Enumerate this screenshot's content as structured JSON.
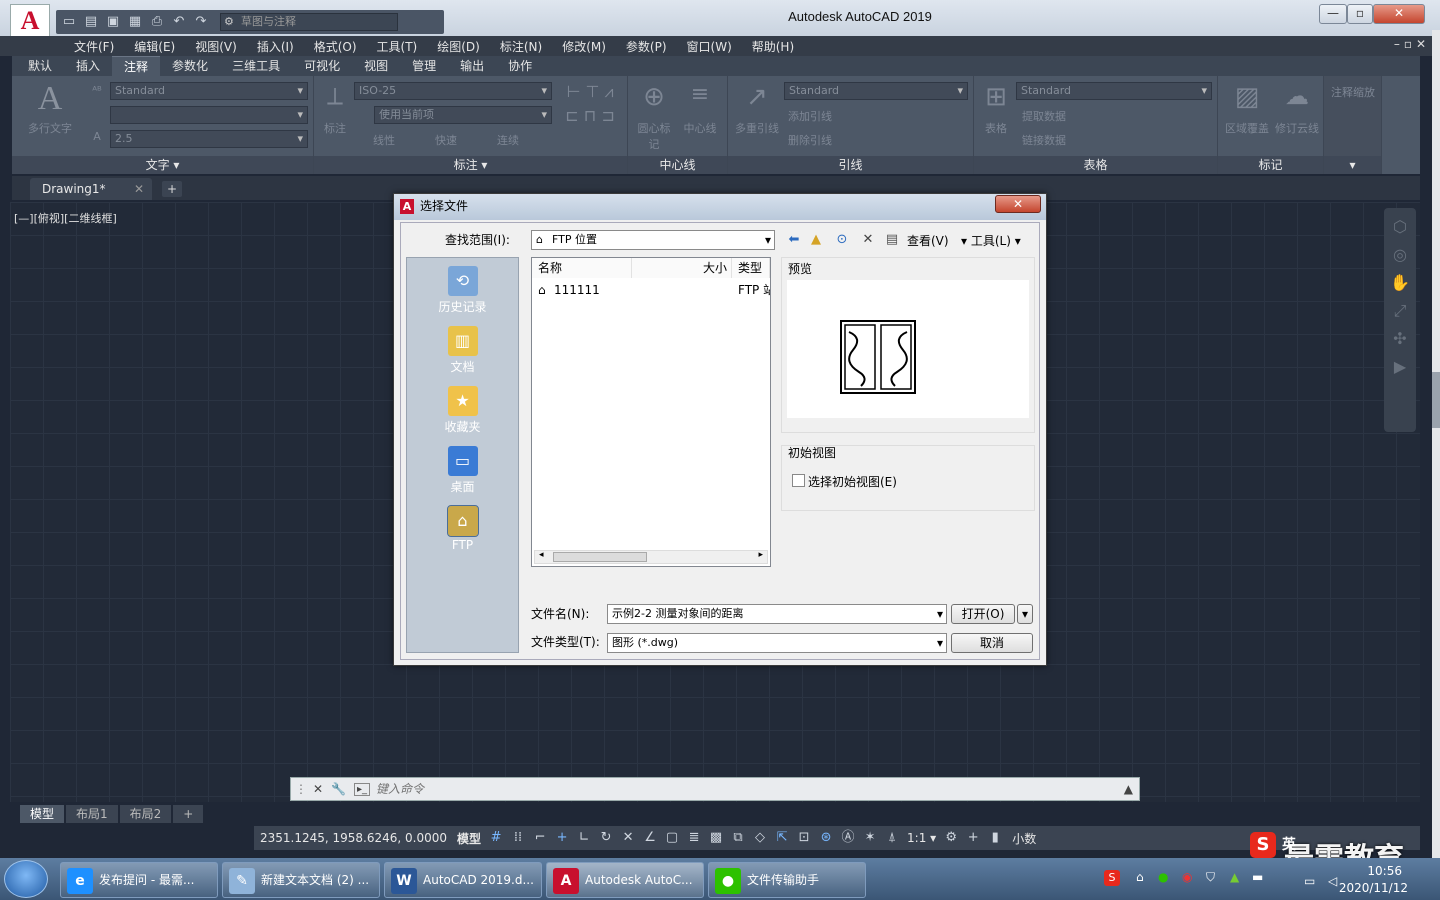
{
  "app": {
    "title": "Autodesk AutoCAD 2019",
    "logo_letter": "A",
    "workspace": "草图与注释"
  },
  "menubar": [
    "文件(F)",
    "编辑(E)",
    "视图(V)",
    "插入(I)",
    "格式(O)",
    "工具(T)",
    "绘图(D)",
    "标注(N)",
    "修改(M)",
    "参数(P)",
    "窗口(W)",
    "帮助(H)"
  ],
  "ribbon_tabs": [
    {
      "label": "默认",
      "active": false
    },
    {
      "label": "插入",
      "active": false
    },
    {
      "label": "注释",
      "active": true
    },
    {
      "label": "参数化",
      "active": false
    },
    {
      "label": "三维工具",
      "active": false
    },
    {
      "label": "可视化",
      "active": false
    },
    {
      "label": "视图",
      "active": false
    },
    {
      "label": "管理",
      "active": false
    },
    {
      "label": "输出",
      "active": false
    },
    {
      "label": "协作",
      "active": false
    }
  ],
  "ribbon": {
    "text_group": {
      "title": "文字 ▾",
      "mtext": "多行文字",
      "style": "Standard",
      "height": "2.5"
    },
    "dim_group": {
      "title": "标注 ▾",
      "dim": "标注",
      "style": "ISO-25",
      "layer": "使用当前项",
      "linear": "线性",
      "quick": "快速",
      "continue": "连续"
    },
    "center_group": {
      "title": "中心线",
      "center_mark": "圆心标记",
      "centerline": "中心线"
    },
    "leader_group": {
      "title": "引线",
      "mleader": "多重引线",
      "style": "Standard",
      "add": "添加引线",
      "remove": "删除引线"
    },
    "table_group": {
      "title": "表格",
      "table": "表格",
      "style": "Standard",
      "extract": "提取数据",
      "link": "链接数据"
    },
    "markup_group": {
      "title": "标记",
      "wipeout": "区域覆盖",
      "revcloud": "修订云线"
    },
    "scale_group": {
      "title": "注释缩放"
    }
  },
  "doc_tab": {
    "name": "Drawing1*",
    "add": "+"
  },
  "viewport_label": "[—][俯视][二维线框]",
  "command": {
    "placeholder": "键入命令"
  },
  "layout_tabs": [
    {
      "label": "模型",
      "active": true
    },
    {
      "label": "布局1",
      "active": false
    },
    {
      "label": "布局2",
      "active": false
    },
    {
      "label": "+",
      "active": false
    }
  ],
  "status": {
    "coords": "2351.1245, 1958.6246, 0.0000",
    "model": "模型",
    "scale": "1:1 ▾",
    "units": "小数"
  },
  "dialog": {
    "title": "选择文件",
    "look_in_label": "查找范围(I):",
    "look_in_value": "FTP 位置",
    "view_label": "查看(V)",
    "tools_label": "工具(L)",
    "places": [
      {
        "label": "历史记录",
        "icon": "history-icon",
        "selected": false
      },
      {
        "label": "文档",
        "icon": "documents-icon",
        "selected": false
      },
      {
        "label": "收藏夹",
        "icon": "favorites-icon",
        "selected": false
      },
      {
        "label": "桌面",
        "icon": "desktop-icon",
        "selected": false
      },
      {
        "label": "FTP",
        "icon": "ftp-icon",
        "selected": true
      }
    ],
    "columns": {
      "name": "名称",
      "size": "大小",
      "type": "类型"
    },
    "files": [
      {
        "name": "111111",
        "type": "FTP 站"
      }
    ],
    "preview_label": "预览",
    "initial_view_label": "初始视图",
    "select_initial_view": "选择初始视图(E)",
    "filename_label": "文件名(N):",
    "filename_value": "示例2-2  测量对象间的距离",
    "filetype_label": "文件类型(T):",
    "filetype_value": "图形 (*.dwg)",
    "open_button": "打开(O)",
    "cancel_button": "取消"
  },
  "taskbar": [
    {
      "label": "发布提问 - 最需...",
      "icon": "ie-icon",
      "color": "#1e90ff",
      "active": false
    },
    {
      "label": "新建文本文档 (2) ...",
      "icon": "notepad-icon",
      "color": "#8fb3d9",
      "active": false
    },
    {
      "label": "AutoCAD 2019.d...",
      "icon": "word-icon",
      "color": "#2b5797",
      "active": false
    },
    {
      "label": "Autodesk AutoC...",
      "icon": "autocad-icon",
      "color": "#c8102e",
      "active": true
    },
    {
      "label": "文件传输助手",
      "icon": "wechat-icon",
      "color": "#2dc100",
      "active": false
    }
  ],
  "tray": {
    "time": "10:56",
    "date": "2020/11/12",
    "ime": "英"
  },
  "watermark": "最需教育"
}
